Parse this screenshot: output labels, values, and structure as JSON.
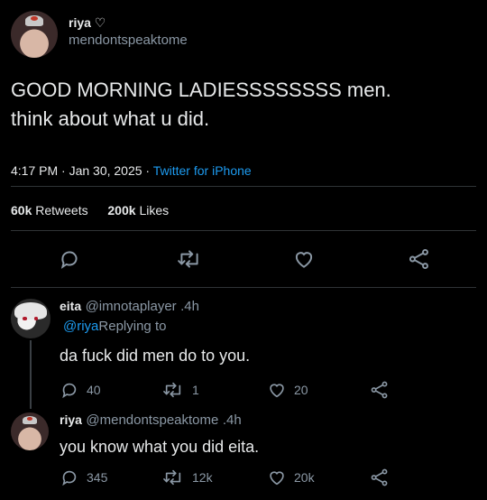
{
  "tweet": {
    "author_name": "riya ♡",
    "author_handle": "mendontspeaktome",
    "text_line1": "GOOD MORNING LADIESSSSSSSS men.",
    "text_line2": "think about what u did.",
    "time": "4:17 PM",
    "date": "· Jan 30, 2025 ·",
    "source": "Twitter for iPhone",
    "retweets_count": "60k",
    "retweets_label": "Retweets",
    "likes_count": "200k",
    "likes_label": "Likes"
  },
  "replies": [
    {
      "author_name": "eita",
      "author_handle": "@imnotaplayer",
      "age": ".4h",
      "reply_to_handle": "@riya",
      "reply_to_label": "Replying to",
      "text": "da fuck did men do to you.",
      "reply_count": "40",
      "retweet_count": "1",
      "like_count": "20"
    },
    {
      "author_name": "riya",
      "author_handle": "@mendontspeaktome",
      "age": ".4h",
      "text": "you know what you did eita.",
      "reply_count": "345",
      "retweet_count": "12k",
      "like_count": "20k"
    }
  ],
  "colors": {
    "background": "#000000",
    "text": "#e7e9ea",
    "muted": "#8b98a5",
    "accent": "#1d9bf0",
    "divider": "#2f3336"
  }
}
